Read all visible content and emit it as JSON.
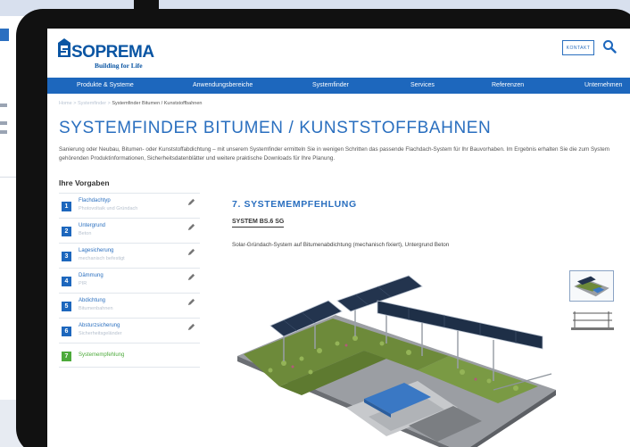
{
  "brand": {
    "name": "SOPREMA",
    "tagline": "Building for Life",
    "color": "#0a55a3"
  },
  "header": {
    "contact_label": "Kontakt",
    "search_icon": "search-icon"
  },
  "nav": {
    "items": [
      "Produkte & Systeme",
      "Anwendungsbereiche",
      "Systemfinder",
      "Services",
      "Referenzen",
      "Unternehmen"
    ],
    "color": "#1d67bd"
  },
  "breadcrumb": {
    "home": "Home",
    "section": "Systemfinder",
    "current": "Systemfinder Bitumen / Kunststoffbahnen"
  },
  "page": {
    "title": "SYSTEMFINDER BITUMEN / KUNSTSTOFFBAHNEN",
    "intro": "Sanierung oder Neubau, Bitumen- oder Kunststoffabdichtung – mit unserem Systemfinder ermitteln Sie in wenigen Schritten das passende Flachdach-System für Ihr Bauvorhaben. Im Ergebnis erhalten Sie die zum System gehörenden Produktinformationen, Sicherheitsdatenblätter und weitere praktische Downloads für Ihre Planung."
  },
  "sidebar": {
    "title": "Ihre Vorgaben",
    "steps": [
      {
        "num": "1",
        "label": "Flachdachtyp",
        "sub": "Photovoltaik und Gründach"
      },
      {
        "num": "2",
        "label": "Untergrund",
        "sub": "Beton"
      },
      {
        "num": "3",
        "label": "Lagesicherung",
        "sub": "mechanisch befestigt"
      },
      {
        "num": "4",
        "label": "Dämmung",
        "sub": "PIR"
      },
      {
        "num": "5",
        "label": "Abdichtung",
        "sub": "Bitumenbahnen"
      },
      {
        "num": "6",
        "label": "Absturzsicherung",
        "sub": "Sicherheitsgeländer"
      },
      {
        "num": "7",
        "label": "Systemempfehlung",
        "sub": ""
      }
    ]
  },
  "result": {
    "heading": "7. SYSTEMEMPFEHLUNG",
    "system_name": "SYSTEM BS.6 SG",
    "description": "Solar-Gründach-System auf Bitumenabdichtung (mechanisch fixiert), Untergrund Beton"
  }
}
